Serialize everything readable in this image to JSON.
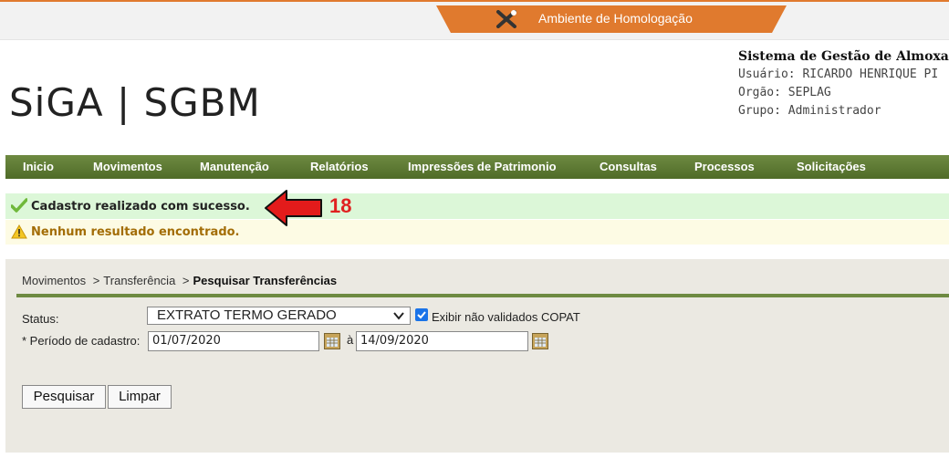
{
  "environment": {
    "label": "Ambiente de Homologação",
    "accent": "#e07a2e"
  },
  "logo": {
    "text": "SiGA | SGBM"
  },
  "system": {
    "title": "Sistema de Gestão de Almoxa",
    "user": "Usuário: RICARDO HENRIQUE PI",
    "org": "Orgão: SEPLAG",
    "group": "Grupo: Administrador"
  },
  "menu": {
    "color": "#5d7a33",
    "items": [
      "Inicio",
      "Movimentos",
      "Manutenção",
      "Relatórios",
      "Impressões de Patrimonio",
      "Consultas",
      "Processos",
      "Solicitações"
    ]
  },
  "messages": {
    "success": "Cadastro realizado com sucesso.",
    "warning": "Nenhum resultado encontrado.",
    "success_icon": "check-icon",
    "warning_icon": "warning-triangle-icon"
  },
  "annotation": {
    "number": "18",
    "color": "#e02020",
    "icon": "red-arrow-icon"
  },
  "breadcrumb": {
    "items": [
      "Movimentos",
      "Transferência"
    ],
    "separator": ">",
    "current": "Pesquisar Transferências"
  },
  "form": {
    "status_label": "Status:",
    "status_value": "EXTRATO TERMO GERADO",
    "checkbox_label": "Exibir não validados COPAT",
    "checkbox_checked": true,
    "period_label": "* Período de cadastro:",
    "date_from": "01/07/2020",
    "date_sep": "à",
    "date_to": "14/09/2020"
  },
  "buttons": {
    "search": "Pesquisar",
    "clear": "Limpar"
  }
}
